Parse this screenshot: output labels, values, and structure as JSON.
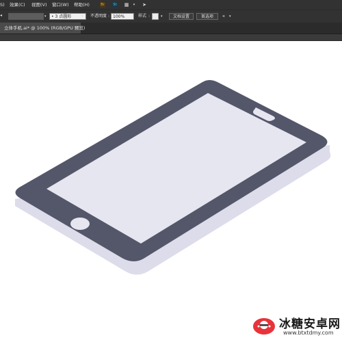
{
  "menubar": {
    "items": [
      "S)",
      "效果(C)",
      "视图(V)",
      "窗口(W)",
      "帮助(H)"
    ],
    "icons": [
      "bridge-icon",
      "stock-icon",
      "arrange-icon",
      "send-icon"
    ],
    "bridge_label": "Br",
    "stock_label": "St"
  },
  "control_bar": {
    "stroke_size": "3",
    "stroke_shape": "点圆形",
    "opacity_label": "不透明度",
    "opacity_value": "100%",
    "style_label": "样式",
    "doc_settings": "文档设置",
    "preferences": "首选项"
  },
  "tab": {
    "title": "立体手机.ai* @ 100% (RGB/GPU 预览)",
    "close": "×"
  },
  "watermark": {
    "title": "冰糖安卓网",
    "url": "www.btxtdmy.com"
  },
  "colors": {
    "phone_body": "#54566a",
    "phone_screen": "#e5e6ef",
    "phone_side": "#dcdcea",
    "ui_dark": "#323232",
    "watermark_red": "#e8333a"
  }
}
